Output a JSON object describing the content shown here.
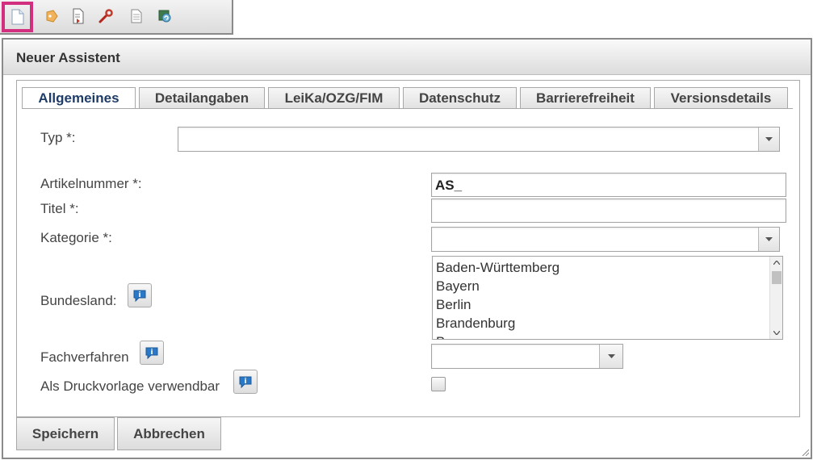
{
  "toolbar": {
    "icons": [
      "new-document-icon",
      "tag-icon",
      "import-icon",
      "wrench-icon",
      "page-icon",
      "refresh-icon"
    ],
    "highlight_color": "#d2307f"
  },
  "dialog": {
    "title": "Neuer Assistent",
    "tabs": [
      "Allgemeines",
      "Detailangaben",
      "LeiKa/OZG/FIM",
      "Datenschutz",
      "Barrierefreiheit",
      "Versionsdetails"
    ],
    "active_tab": "Allgemeines"
  },
  "form": {
    "typ_label": "Typ *:",
    "typ_value": "",
    "artikelnummer_label": "Artikelnummer *:",
    "artikelnummer_value": "AS_",
    "titel_label": "Titel *:",
    "titel_value": "",
    "kategorie_label": "Kategorie *:",
    "kategorie_value": "",
    "bundesland_label": "Bundesland:",
    "bundesland_options": [
      "Baden-Württemberg",
      "Bayern",
      "Berlin",
      "Brandenburg",
      "Bremen"
    ],
    "fachverfahren_label": "Fachverfahren",
    "fachverfahren_value": "",
    "druckvorlage_label": "Als Druckvorlage verwendbar",
    "druckvorlage_checked": false
  },
  "buttons": {
    "save": "Speichern",
    "cancel": "Abbrechen"
  },
  "colors": {
    "active_tab_text": "#1f3c68",
    "info_icon": "#2a78c8"
  }
}
